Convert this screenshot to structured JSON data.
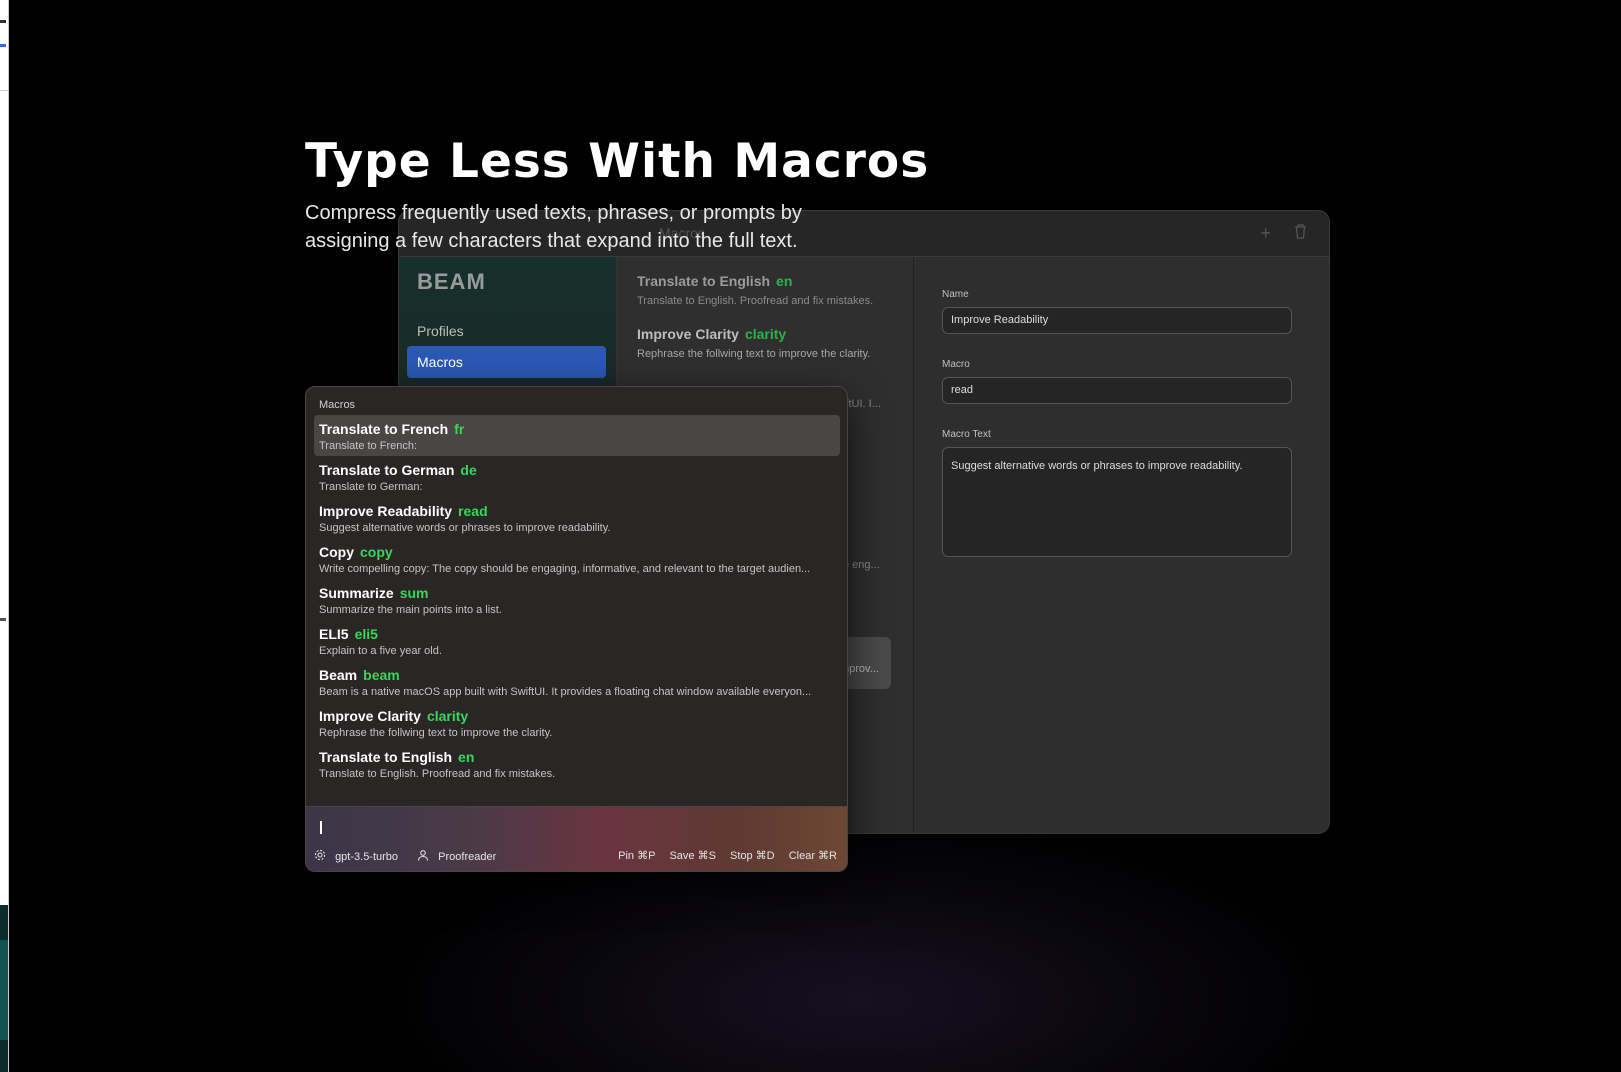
{
  "hero": {
    "title": "Type Less With Macros",
    "subtitle": "Compress frequently used texts, phrases, or prompts by assigning a few characters that expand into the full text."
  },
  "settings_window": {
    "title": "Macros",
    "logo": "BEAM",
    "nav": [
      "Profiles",
      "Macros"
    ],
    "active_nav": "Macros",
    "list": [
      {
        "title": "Translate to English",
        "macro": "en",
        "desc": "Translate to English. Proofread and fix mistakes."
      },
      {
        "title": "Improve Clarity",
        "macro": "clarity",
        "desc": "Rephrase the follwing text to improve the clarity."
      }
    ],
    "list_fragments": [
      "iftUI. I...",
      "e eng...",
      "nprov..."
    ],
    "form": {
      "name_label": "Name",
      "name_value": "Improve Readability",
      "macro_label": "Macro",
      "macro_value": "read",
      "text_label": "Macro Text",
      "text_value": "Suggest alternative words or phrases to improve readability."
    }
  },
  "popup": {
    "header": "Macros",
    "selected_index": 0,
    "items": [
      {
        "title": "Translate to French",
        "macro": "fr",
        "desc": "Translate to French:"
      },
      {
        "title": "Translate to German",
        "macro": "de",
        "desc": "Translate to German:"
      },
      {
        "title": "Improve Readability",
        "macro": "read",
        "desc": "Suggest alternative words or phrases to improve readability."
      },
      {
        "title": "Copy",
        "macro": "copy",
        "desc": "Write compelling copy: The copy should be engaging, informative, and relevant to the target audien..."
      },
      {
        "title": "Summarize",
        "macro": "sum",
        "desc": "Summarize the main points into a list."
      },
      {
        "title": "ELI5",
        "macro": "eli5",
        "desc": "Explain to a five year old."
      },
      {
        "title": "Beam",
        "macro": "beam",
        "desc": "Beam is a native macOS app built with SwiftUI. It provides a floating chat window available everyon..."
      },
      {
        "title": "Improve Clarity",
        "macro": "clarity",
        "desc": "Rephrase the follwing text to improve the clarity."
      },
      {
        "title": "Translate to English",
        "macro": "en",
        "desc": "Translate to English. Proofread and fix mistakes."
      }
    ],
    "model": "gpt-3.5-turbo",
    "profile": "Proofreader",
    "shortcuts": [
      "Pin ⌘P",
      "Save ⌘S",
      "Stop ⌘D",
      "Clear ⌘R"
    ]
  },
  "colors": {
    "macro_green": "#38d65a",
    "active_nav": "#2c58b6",
    "background": "#000000"
  }
}
